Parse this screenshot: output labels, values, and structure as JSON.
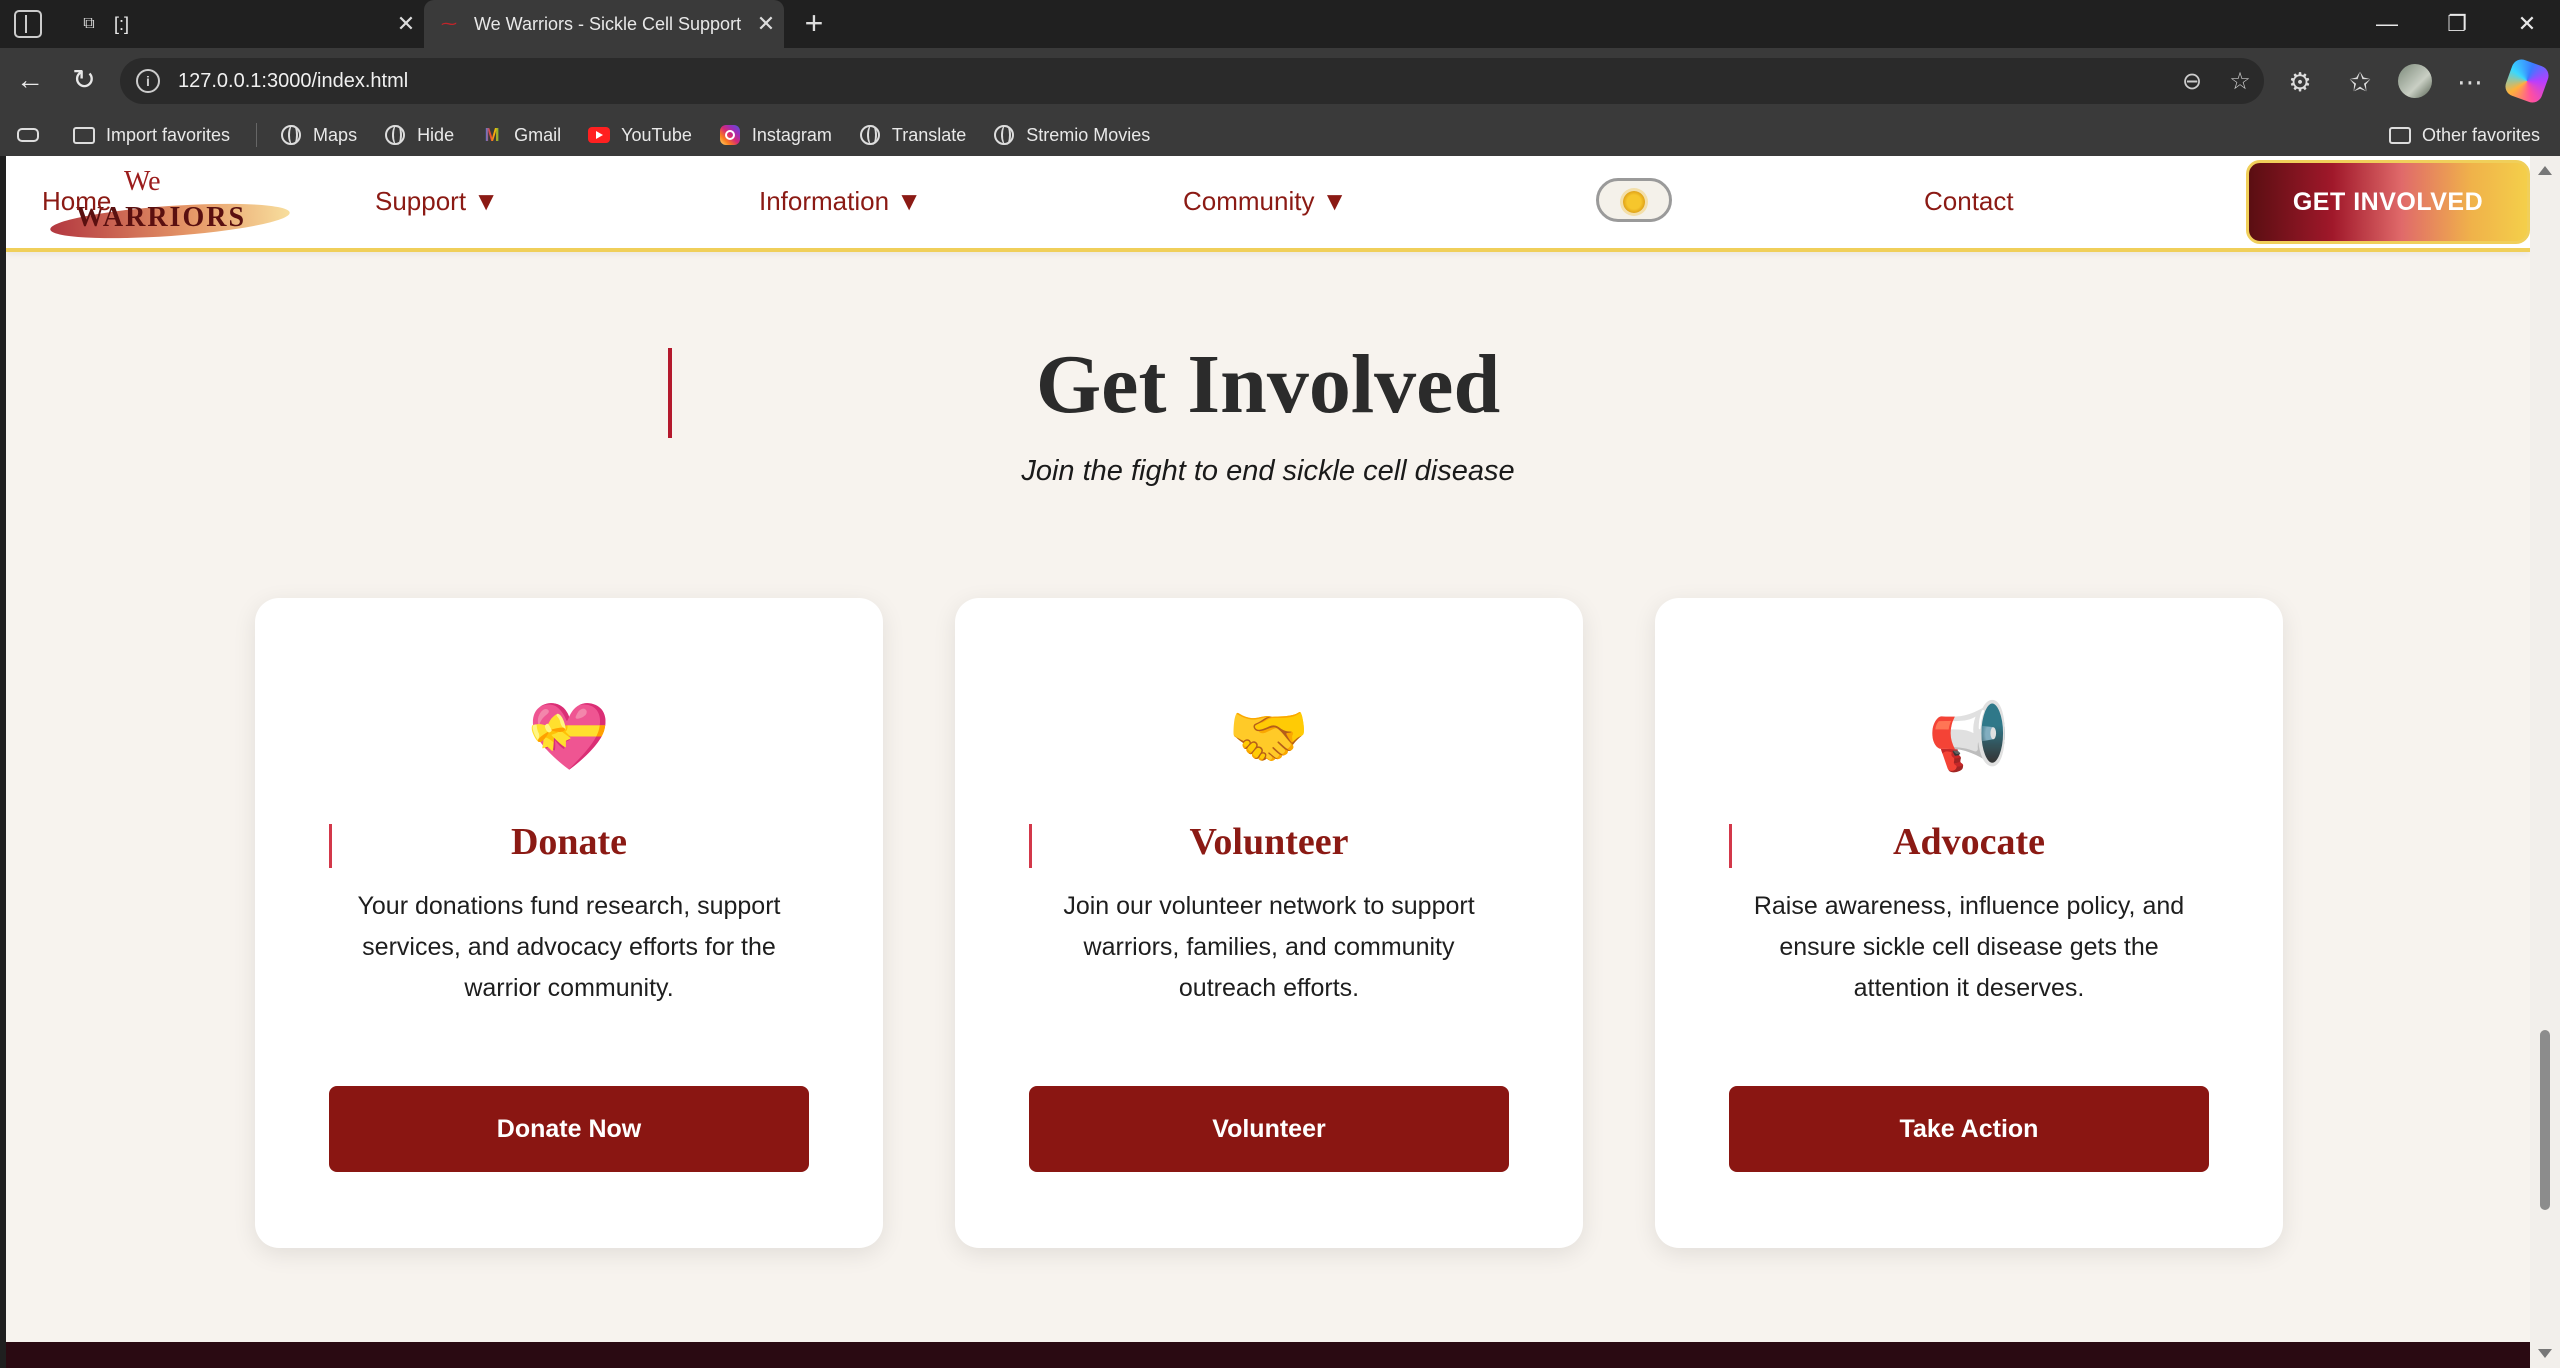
{
  "browser": {
    "tabs": [
      {
        "title": "[:]",
        "active": false
      },
      {
        "title": "We Warriors - Sickle Cell Support",
        "active": true
      }
    ],
    "url": "127.0.0.1:3000/index.html",
    "bookmarks": [
      {
        "label": "Import favorites",
        "icon": "import-icon"
      },
      {
        "label": "Maps",
        "icon": "globe-icon"
      },
      {
        "label": "Hide",
        "icon": "globe-icon"
      },
      {
        "label": "Gmail",
        "icon": "gmail-icon"
      },
      {
        "label": "YouTube",
        "icon": "youtube-icon"
      },
      {
        "label": "Instagram",
        "icon": "instagram-icon"
      },
      {
        "label": "Translate",
        "icon": "globe-icon"
      },
      {
        "label": "Stremio Movies",
        "icon": "globe-icon"
      }
    ],
    "other_favorites": "Other favorites"
  },
  "site": {
    "logo": {
      "we": "We",
      "warriors": "WARRIORS"
    },
    "nav": {
      "home": "Home",
      "support": "Support ▼",
      "information": "Information ▼",
      "community": "Community ▼",
      "contact": "Contact",
      "cta": "GET INVOLVED"
    },
    "theme_toggle": {
      "state": "light",
      "icon": "sun-icon"
    },
    "colors": {
      "brand": "#8a1612",
      "accent": "#f0cf5a",
      "background": "#f7f3ee"
    }
  },
  "section": {
    "title": "Get Involved",
    "subtitle": "Join the fight to end sickle cell disease"
  },
  "cards": [
    {
      "emoji": "💝",
      "icon": "heart-gift-icon",
      "title": "Donate",
      "text": "Your donations fund research, support services, and advocacy efforts for the warrior community.",
      "button": "Donate Now"
    },
    {
      "emoji": "🤝",
      "icon": "handshake-icon",
      "title": "Volunteer",
      "text": "Join our volunteer network to support warriors, families, and community outreach efforts.",
      "button": "Volunteer"
    },
    {
      "emoji": "📢",
      "icon": "megaphone-icon",
      "title": "Advocate",
      "text": "Raise awareness, influence policy, and ensure sickle cell disease gets the attention it deserves.",
      "button": "Take Action"
    }
  ]
}
